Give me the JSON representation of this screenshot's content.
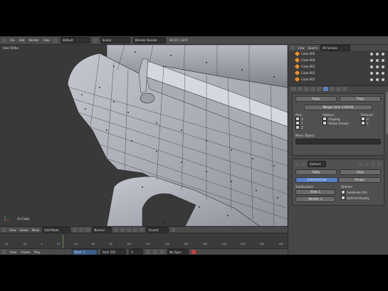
{
  "top_menu": {
    "items": [
      "File",
      "Add",
      "Render",
      "Help"
    ]
  },
  "header": {
    "layout": "Default",
    "scene": "Scene",
    "engine": "Blender Render",
    "stats": "Ve:0-5 | Ed:0"
  },
  "viewport": {
    "label": "User Ortho",
    "object_label": "(1) Cube"
  },
  "viewport_header": {
    "items": [
      "View",
      "Select",
      "Mesh"
    ],
    "mode": "Edit Mode",
    "pivot": "Normal",
    "snap": "Closest"
  },
  "timeline": {
    "ruler": [
      "-40",
      "-20",
      "0",
      "20",
      "40",
      "60",
      "80",
      "100",
      "120",
      "140",
      "160",
      "180",
      "200",
      "220",
      "240",
      "260"
    ],
    "menu": [
      "View",
      "Frame",
      "Play"
    ],
    "start": "Start: 1",
    "end": "End: 250",
    "frame": "1",
    "sync": "No Sync"
  },
  "outliner": {
    "header": [
      "View",
      "Search",
      "All Scenes"
    ],
    "rows": [
      "Cube.005",
      "Cube.004",
      "Cube.003",
      "Cube.002",
      "Cube.001"
    ]
  },
  "mirror_modifier": {
    "apply": "Apply",
    "copy": "Copy",
    "merge_limit": "Merge Limit: 0.00100",
    "axis_label": "Axis:",
    "options_label": "Options:",
    "textures_label": "Textures:",
    "axes": [
      "X",
      "Y",
      "Z"
    ],
    "options": [
      "Clipping",
      "Vertex Groups"
    ],
    "textures": [
      "U",
      "V"
    ],
    "mirror_object_label": "Mirror Object:"
  },
  "subsurf_modifier": {
    "name": "Subsurf",
    "apply": "Apply",
    "copy": "Copy",
    "type_catmull": "Catmull-Clark",
    "type_simple": "Simple",
    "subdivisions_label": "Subdivisions:",
    "options_label": "Options:",
    "view": "View: 1",
    "render": "Render: 2",
    "subdivide_uvs": "Subdivide UVs",
    "optimal_display": "Optimal Display"
  }
}
